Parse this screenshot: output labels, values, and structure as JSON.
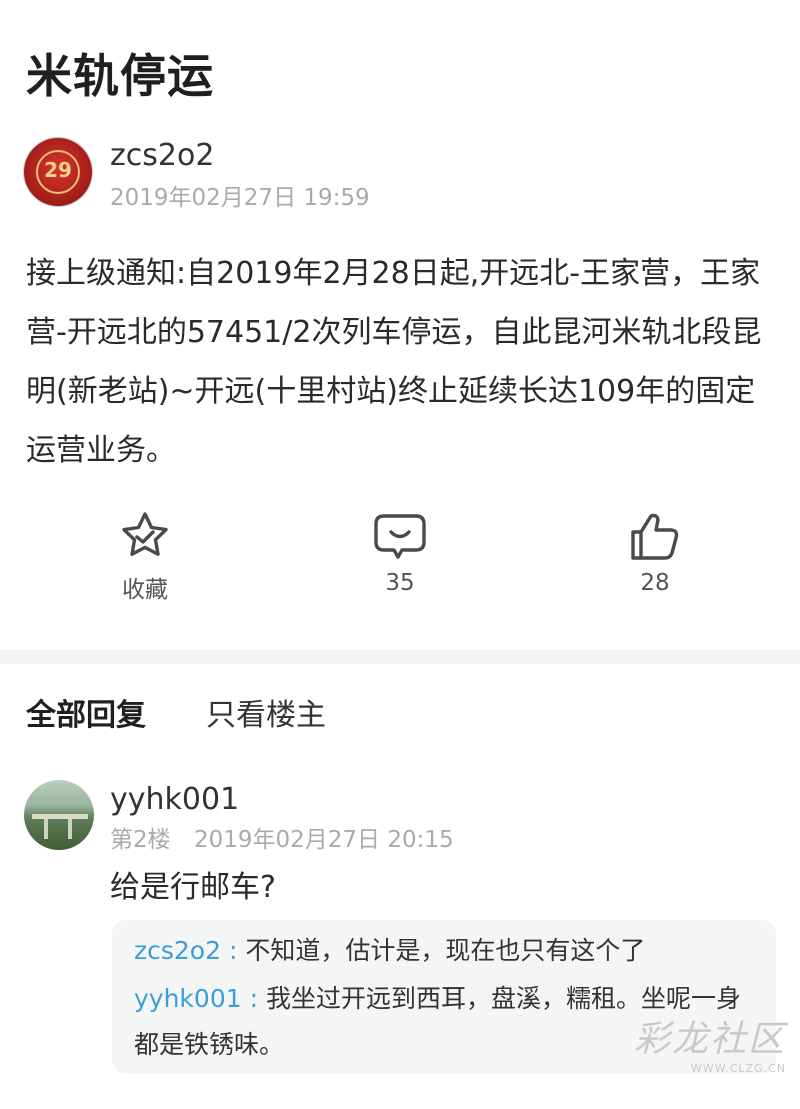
{
  "post": {
    "title": "米轨停运",
    "author": "zcs2o2",
    "avatar_badge": "29",
    "time": "2019年02月27日 19:59",
    "body": "接上级通知:自2019年2月28日起,开远北-王家营，王家营-开远北的57451/2次列车停运，自此昆河米轨北段昆明(新老站)~开远(十里村站)终止延续长达109年的固定运营业务。"
  },
  "actions": {
    "favorite": {
      "label": "收藏",
      "icon": "star-check-icon"
    },
    "comment": {
      "label": "35",
      "icon": "chat-bubble-icon"
    },
    "like": {
      "label": "28",
      "icon": "thumbs-up-icon"
    }
  },
  "tabs": {
    "all_replies": "全部回复",
    "op_only": "只看楼主"
  },
  "reply": {
    "author": "yyhk001",
    "floor": "第2楼",
    "time": "2019年02月27日 20:15",
    "text": "给是行邮车?",
    "sub_replies": [
      {
        "user": "zcs2o2 :",
        "text": " 不知道，估计是，现在也只有这个了"
      },
      {
        "user": "yyhk001 :",
        "text": " 我坐过开远到西耳，盘溪，糯租。坐呢一身都是铁锈味。"
      }
    ]
  },
  "watermark": {
    "text": "彩龙社区",
    "url": "WWW.CLZG.CN"
  },
  "colors": {
    "link": "#3a9fd6",
    "icon": "#4a4a4a",
    "muted": "#aaaaaa"
  }
}
